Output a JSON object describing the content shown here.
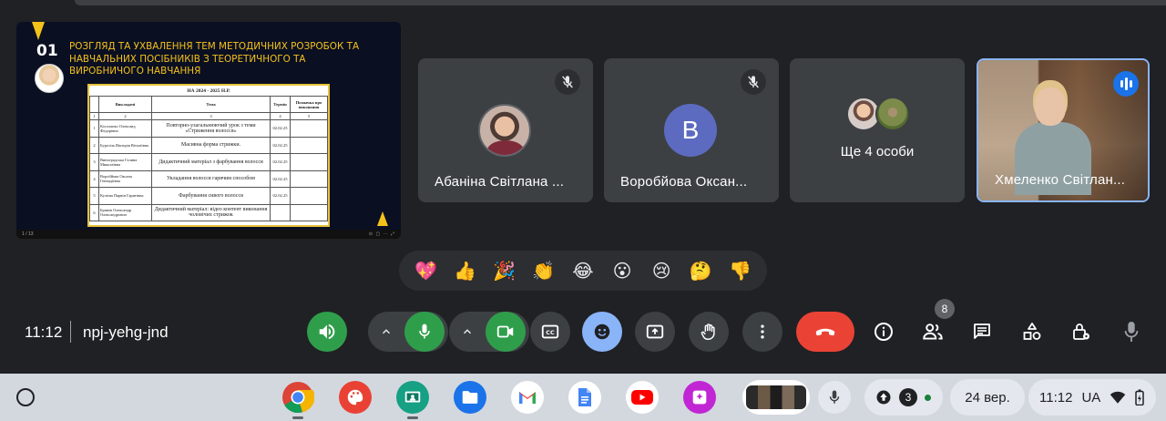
{
  "presentation": {
    "slide_number": "01",
    "slide_title": "РОЗГЛЯД ТА УХВАЛЕННЯ ТЕМ МЕТОДИЧНИХ РОЗРОБОК ТА НАВЧАЛЬНИХ ПОСІБНИКІВ З ТЕОРЕТИЧНОГО ТА ВИРОБНИЧОГО НАВЧАННЯ",
    "doc_heading": "НА 2024 - 2025 Н.Р.",
    "doc_headers": [
      "",
      "Викладачі",
      "Тема",
      "Термін",
      "Позначка про виконання"
    ],
    "doc_index_row": [
      "1",
      "2",
      "3",
      "4",
      "5"
    ],
    "doc_rows": [
      {
        "n": "1",
        "name": "Косолапко Олександ Федорівна",
        "topic": "Повторно-узагальнюючий урок з теми «Стриження волосся»",
        "term": "02.02.25",
        "mark": ""
      },
      {
        "n": "2",
        "name": "Бурґоіль Вікторія Віталіївна",
        "topic": "Масивна форма стрижки.",
        "term": "02.02.25",
        "mark": ""
      },
      {
        "n": "3",
        "name": "Виноградська Галина Миколаївна",
        "topic": "Дидактичний матеріал з фарбування волосся",
        "term": "02.02.25",
        "mark": ""
      },
      {
        "n": "4",
        "name": "Воробйова Оксана Геннадіївна",
        "topic": "Укладання волосся гарячим способом",
        "term": "02.02.25",
        "mark": ""
      },
      {
        "n": "5",
        "name": "Кулієва Парвін Гаритівна",
        "topic": "Фарбування сивого волосся",
        "term": "02.02.25",
        "mark": ""
      },
      {
        "n": "6",
        "name": "Бравов Олександр Олександрович",
        "topic": "Дидактичний матеріал: відео контент виконання чоловічих стрижок",
        "term": "",
        "mark": ""
      }
    ],
    "controls_left": "1 / 13",
    "controls_right": "⊙ ▢ ⋯ ⤢"
  },
  "participants": [
    {
      "name": "Абаніна Світлана ...",
      "avatar": "photo",
      "muted": true
    },
    {
      "name": "Воробйова Оксан...",
      "avatar": "letter",
      "letter": "B",
      "muted": true
    },
    {
      "name": "Хмеленко Світлан...",
      "avatar": "video",
      "speaking": true
    }
  ],
  "more_participants": {
    "label": "Ще 4 особи"
  },
  "reactions": [
    "💖",
    "👍",
    "🎉",
    "👏",
    "😂",
    "😮",
    "😢",
    "🤔",
    "👎"
  ],
  "meeting": {
    "time": "11:12",
    "code": "npj-yehg-jnd",
    "people_count": "8"
  },
  "icons": {
    "speaker": "volume-icon",
    "mic": "microphone-icon",
    "camera": "camera-icon",
    "captions": "captions-icon",
    "emoji": "emoji-icon",
    "present": "present-icon",
    "hand": "raise-hand-icon",
    "more": "more-vert-icon",
    "end": "end-call-icon",
    "info": "info-icon",
    "people": "people-icon",
    "chat": "chat-icon",
    "activities": "activities-icon",
    "host": "host-controls-icon"
  },
  "shelf": {
    "notif_count": "3",
    "date": "24 вер.",
    "time": "11:12",
    "lang": "UA"
  },
  "colors": {
    "background": "#202124",
    "tile": "#3c4043",
    "green": "#2f9e4b",
    "red": "#ea4335",
    "blue": "#8ab4f8",
    "accent_yellow": "#f4c21b"
  }
}
